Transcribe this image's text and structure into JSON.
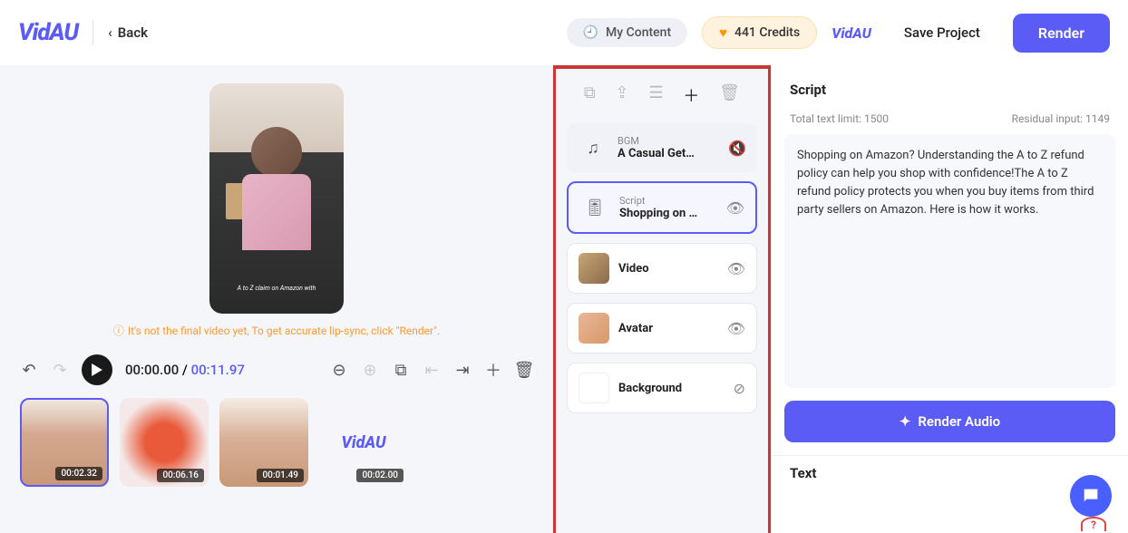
{
  "header": {
    "logo": "VidAU",
    "back": "Back",
    "myContent": "My Content",
    "credits": "441 Credits",
    "save": "Save Project",
    "render": "Render"
  },
  "preview": {
    "caption": "A to Z claim on Amazon with",
    "notice": "It's not the final video yet, To get accurate lip-sync, click \"Render\"."
  },
  "timeline": {
    "current": "00:00.00",
    "duration": "00:11.97",
    "thumbs": [
      "00:02.32",
      "00:06.16",
      "00:01.49",
      "00:02.00"
    ]
  },
  "layers": {
    "bgm": {
      "label": "BGM",
      "title": "A Casual Get…"
    },
    "script": {
      "label": "Script",
      "title": "Shopping on …"
    },
    "video": {
      "title": "Video"
    },
    "avatar": {
      "title": "Avatar"
    },
    "background": {
      "title": "Background"
    }
  },
  "script": {
    "heading": "Script",
    "limitLabel": "Total text limit: 1500",
    "residualLabel": "Residual input: 1149",
    "body": "Shopping on Amazon? Understanding the A to Z refund policy can help you shop with confidence!The A to Z refund policy protects you when you buy items from third party sellers on Amazon. Here is how it works.",
    "renderAudio": "Render Audio",
    "textHeading": "Text"
  }
}
